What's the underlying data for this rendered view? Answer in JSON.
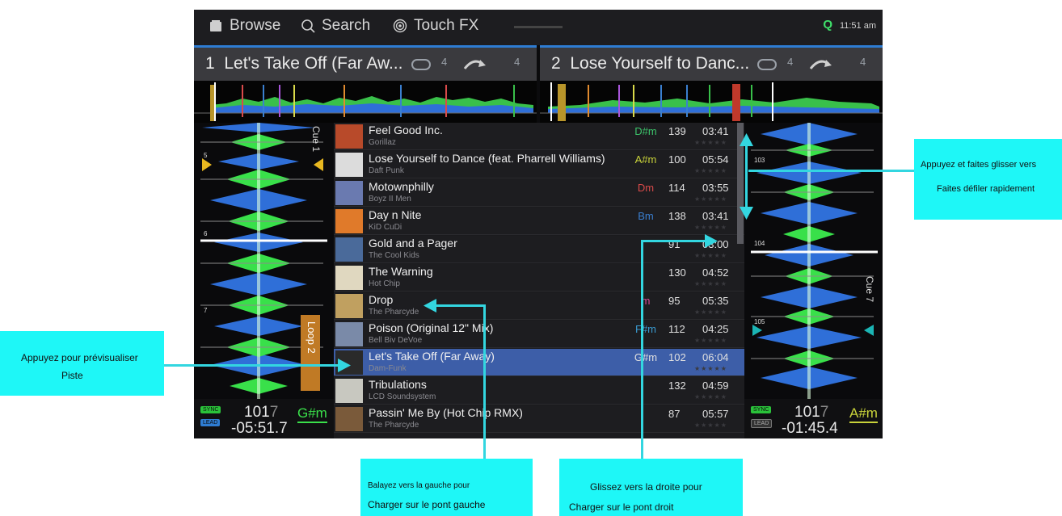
{
  "topbar": {
    "browse_label": "Browse",
    "search_label": "Search",
    "touchfx_label": "Touch FX",
    "status_letter": "Q",
    "clock": "11:51 am"
  },
  "deck1": {
    "number": "1",
    "title": "Let's Take Off (Far Aw...",
    "loop_count": "4",
    "jump_count": "4",
    "cue_label": "Cue 1",
    "loop_label": "Loop 2",
    "markers": [
      "5",
      "6",
      "7"
    ],
    "bpm_main": "101",
    "bpm_decimal": "7",
    "key": "G#m",
    "time_remaining": "-05:51.7",
    "sync_label": "SYNC",
    "lead_label": "LEAD"
  },
  "deck2": {
    "number": "2",
    "title": "Lose Yourself to Danc...",
    "loop_count": "4",
    "jump_count": "4",
    "cue_label": "Cue 7",
    "markers": [
      "103",
      "104",
      "105"
    ],
    "bpm_main": "101",
    "bpm_decimal": "7",
    "key": "A#m",
    "time_remaining": "-01:45.4",
    "sync_label": "SYNC",
    "lead_label": "LEAD"
  },
  "tracks": [
    {
      "title": "Feel Good Inc.",
      "artist": "Gorillaz",
      "key": "D#m",
      "key_color": "#3cc36a",
      "bpm": "139",
      "length": "03:41"
    },
    {
      "title": "Lose Yourself to Dance (feat. Pharrell Williams)",
      "artist": "Daft Punk",
      "key": "A#m",
      "key_color": "#c9d33a",
      "bpm": "100",
      "length": "05:54"
    },
    {
      "title": "Motownphilly",
      "artist": "Boyz II Men",
      "key": "Dm",
      "key_color": "#d94a4a",
      "bpm": "114",
      "length": "03:55"
    },
    {
      "title": "Day n Nite",
      "artist": "KiD CuDi",
      "key": "Bm",
      "key_color": "#3a7fd0",
      "bpm": "138",
      "length": "03:41"
    },
    {
      "title": "Gold and a Pager",
      "artist": "The Cool Kids",
      "key": "",
      "key_color": "#999999",
      "bpm": "91",
      "length": "03:00"
    },
    {
      "title": "The Warning",
      "artist": "Hot Chip",
      "key": "",
      "key_color": "#999999",
      "bpm": "130",
      "length": "04:52"
    },
    {
      "title": "Drop",
      "artist": "The Pharcyde",
      "key": "m",
      "key_color": "#d94a9a",
      "bpm": "95",
      "length": "05:35"
    },
    {
      "title": "Poison (Original 12\" Mix)",
      "artist": "Bell Biv DeVoe",
      "key": "F#m",
      "key_color": "#3a9ad0",
      "bpm": "112",
      "length": "04:25"
    },
    {
      "title": "Let's Take Off (Far Away)",
      "artist": "Dam-Funk",
      "key": "G#m",
      "key_color": "#e0e0e0",
      "bpm": "102",
      "length": "06:04"
    },
    {
      "title": "Tribulations",
      "artist": "LCD Soundsystem",
      "key": "",
      "key_color": "#999999",
      "bpm": "132",
      "length": "04:59"
    },
    {
      "title": "Passin' Me By (Hot Chip RMX)",
      "artist": "The Pharcyde",
      "key": "",
      "key_color": "#999999",
      "bpm": "87",
      "length": "05:57"
    }
  ],
  "selected_index": 8,
  "annotations": {
    "scroll_line1": "Appuyez et faites glisser vers",
    "scroll_line2": "Faites défiler rapidement",
    "preview_line1": "Appuyez pour prévisualiser",
    "preview_line2": "Piste",
    "left_line1": "Balayez vers la gauche pour",
    "left_line2": "Charger sur le pont gauche",
    "right_line1": "Glissez vers la droite pour",
    "right_line2": "Charger sur le pont droit"
  },
  "colors": {
    "accent_blue": "#2e7cd2",
    "selected_row": "#3d5ea8",
    "annotation_box": "#1ef7f7",
    "wave_green": "#39e04a",
    "wave_blue": "#2f6fd8"
  }
}
